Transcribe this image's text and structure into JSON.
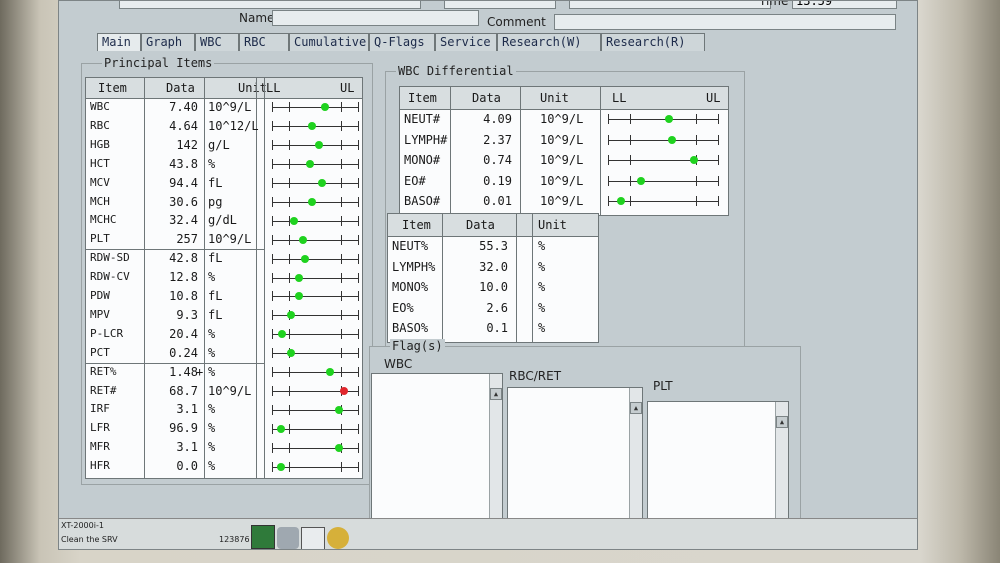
{
  "header": {
    "name_label": "Name",
    "comment_label": "Comment",
    "time_label": "Time",
    "time_value": "13:59"
  },
  "tabs": [
    "Main",
    "Graph",
    "WBC",
    "RBC",
    "Cumulative",
    "Q-Flags",
    "Service",
    "Research(W)",
    "Research(R)"
  ],
  "principal": {
    "title": "Principal Items",
    "headers": {
      "item": "Item",
      "data": "Data",
      "unit": "Unit",
      "ll": "LL",
      "ul": "UL"
    },
    "rows": [
      {
        "item": "WBC",
        "data": "7.40",
        "flag": "",
        "unit": "10^9/L",
        "pos": 0.62,
        "status": "normal"
      },
      {
        "item": "RBC",
        "data": "4.64",
        "flag": "",
        "unit": "10^12/L",
        "pos": 0.47,
        "status": "normal"
      },
      {
        "item": "HGB",
        "data": "142",
        "flag": "",
        "unit": "g/L",
        "pos": 0.55,
        "status": "normal"
      },
      {
        "item": "HCT",
        "data": "43.8",
        "flag": "",
        "unit": "%",
        "pos": 0.44,
        "status": "normal"
      },
      {
        "item": "MCV",
        "data": "94.4",
        "flag": "",
        "unit": "fL",
        "pos": 0.58,
        "status": "normal"
      },
      {
        "item": "MCH",
        "data": "30.6",
        "flag": "",
        "unit": "pg",
        "pos": 0.46,
        "status": "normal"
      },
      {
        "item": "MCHC",
        "data": "32.4",
        "flag": "",
        "unit": "g/dL",
        "pos": 0.26,
        "status": "normal"
      },
      {
        "item": "PLT",
        "data": "257",
        "flag": "",
        "unit": "10^9/L",
        "pos": 0.36,
        "status": "normal"
      },
      {
        "item": "RDW-SD",
        "data": "42.8",
        "flag": "",
        "unit": "fL",
        "pos": 0.38,
        "status": "normal"
      },
      {
        "item": "RDW-CV",
        "data": "12.8",
        "flag": "",
        "unit": "%",
        "pos": 0.31,
        "status": "normal"
      },
      {
        "item": "PDW",
        "data": "10.8",
        "flag": "",
        "unit": "fL",
        "pos": 0.31,
        "status": "normal"
      },
      {
        "item": "MPV",
        "data": "9.3",
        "flag": "",
        "unit": "fL",
        "pos": 0.22,
        "status": "normal"
      },
      {
        "item": "P-LCR",
        "data": "20.4",
        "flag": "",
        "unit": "%",
        "pos": 0.12,
        "status": "normal"
      },
      {
        "item": "PCT",
        "data": "0.24",
        "flag": "",
        "unit": "%",
        "pos": 0.22,
        "status": "normal"
      },
      {
        "item": "RET%",
        "data": "1.48",
        "flag": "+",
        "unit": "%",
        "pos": 0.68,
        "status": "normal"
      },
      {
        "item": "RET#",
        "data": "68.7",
        "flag": "",
        "unit": "10^9/L",
        "pos": 0.84,
        "status": "high"
      },
      {
        "item": "IRF",
        "data": "3.1",
        "flag": "",
        "unit": "%",
        "pos": 0.78,
        "status": "normal"
      },
      {
        "item": "LFR",
        "data": "96.9",
        "flag": "",
        "unit": "%",
        "pos": 0.1,
        "status": "normal"
      },
      {
        "item": "MFR",
        "data": "3.1",
        "flag": "",
        "unit": "%",
        "pos": 0.78,
        "status": "normal"
      },
      {
        "item": "HFR",
        "data": "0.0",
        "flag": "",
        "unit": "%",
        "pos": 0.1,
        "status": "normal"
      }
    ]
  },
  "wbc_diff": {
    "title": "WBC Differential",
    "headers": {
      "item": "Item",
      "data": "Data",
      "unit": "Unit",
      "ll": "LL",
      "ul": "UL"
    },
    "abs_rows": [
      {
        "item": "NEUT#",
        "data": "4.09",
        "unit": "10^9/L",
        "pos": 0.55
      },
      {
        "item": "LYMPH#",
        "data": "2.37",
        "unit": "10^9/L",
        "pos": 0.58
      },
      {
        "item": "MONO#",
        "data": "0.74",
        "unit": "10^9/L",
        "pos": 0.78
      },
      {
        "item": "EO#",
        "data": "0.19",
        "unit": "10^9/L",
        "pos": 0.3
      },
      {
        "item": "BASO#",
        "data": "0.01",
        "unit": "10^9/L",
        "pos": 0.12
      }
    ],
    "pct_headers": {
      "item": "Item",
      "data": "Data",
      "unit": "Unit"
    },
    "pct_rows": [
      {
        "item": "NEUT%",
        "data": "55.3",
        "unit": "%"
      },
      {
        "item": "LYMPH%",
        "data": "32.0",
        "unit": "%"
      },
      {
        "item": "MONO%",
        "data": "10.0",
        "unit": "%"
      },
      {
        "item": "EO%",
        "data": "2.6",
        "unit": "%"
      },
      {
        "item": "BASO%",
        "data": "0.1",
        "unit": "%"
      }
    ]
  },
  "flags": {
    "title": "Flag(s)",
    "wbc": "WBC",
    "rbc": "RBC/RET",
    "plt": "PLT"
  },
  "status": {
    "model": "XT-2000i-1",
    "message": "Clean the SRV",
    "id": "123876"
  },
  "colors": {
    "normal": "#1fd21f",
    "high": "#e0262c"
  }
}
